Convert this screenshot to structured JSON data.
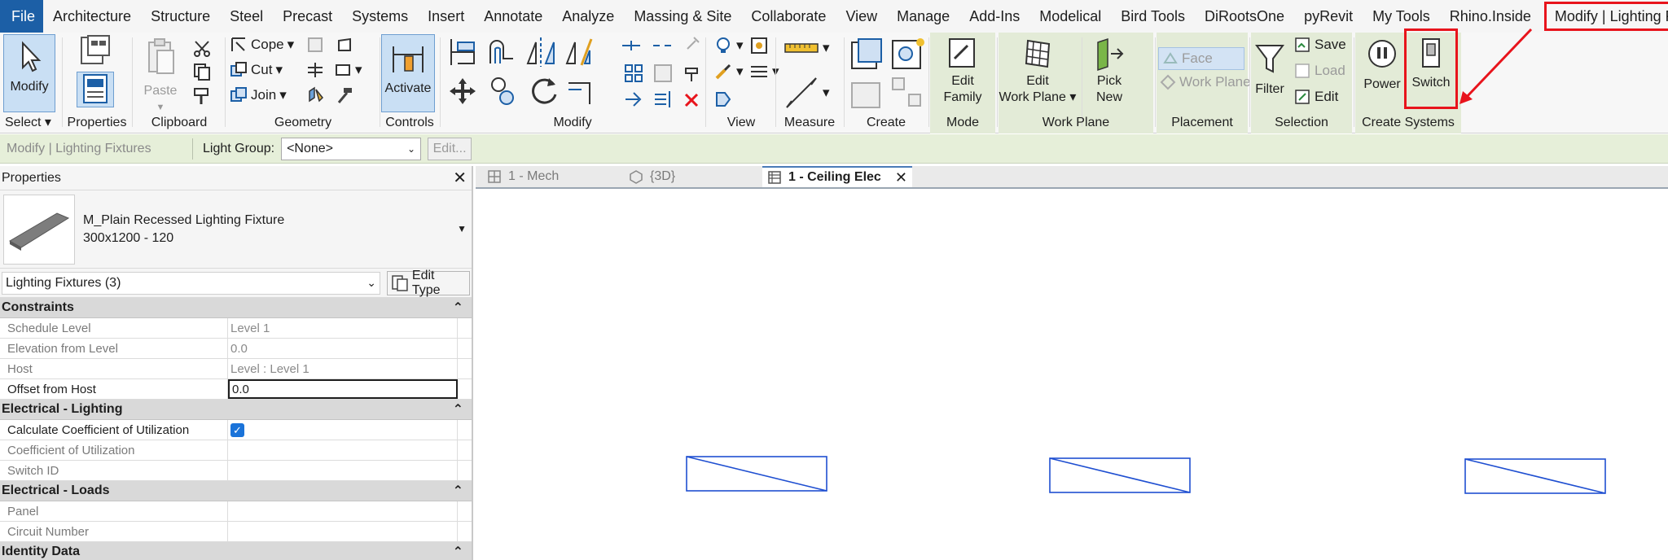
{
  "menu": {
    "file": "File",
    "tabs": [
      "Architecture",
      "Structure",
      "Steel",
      "Precast",
      "Systems",
      "Insert",
      "Annotate",
      "Analyze",
      "Massing & Site",
      "Collaborate",
      "View",
      "Manage",
      "Add-Ins",
      "Modelical",
      "Bird Tools",
      "DiRootsOne",
      "pyRevit",
      "My Tools",
      "Rhino.Inside"
    ],
    "context_tab": "Modify | Lighting Fixtures"
  },
  "ribbon": {
    "select": {
      "modify": "Modify",
      "label": "Select"
    },
    "properties": {
      "label": "Properties"
    },
    "clipboard": {
      "paste": "Paste",
      "label": "Clipboard"
    },
    "geometry": {
      "cope": "Cope",
      "cut": "Cut",
      "join": "Join",
      "label": "Geometry"
    },
    "controls": {
      "activate": "Activate",
      "label": "Controls"
    },
    "modify": {
      "label": "Modify"
    },
    "view": {
      "label": "View"
    },
    "measure": {
      "label": "Measure"
    },
    "create": {
      "label": "Create"
    },
    "mode": {
      "edit_family_1": "Edit",
      "edit_family_2": "Family",
      "label": "Mode"
    },
    "work_plane": {
      "edit_1": "Edit",
      "edit_2": "Work Plane",
      "pick_1": "Pick",
      "pick_2": "New",
      "label": "Work Plane"
    },
    "placement": {
      "face": "Face",
      "work_plane": "Work Plane",
      "label": "Placement"
    },
    "selection": {
      "filter": "Filter",
      "save": "Save",
      "load": "Load",
      "edit": "Edit",
      "label": "Selection"
    },
    "create_systems": {
      "power": "Power",
      "switch": "Switch",
      "label": "Create Systems"
    }
  },
  "options_bar": {
    "context": "Modify | Lighting Fixtures",
    "light_group_label": "Light Group:",
    "light_group_value": "<None>",
    "edit_button": "Edit..."
  },
  "properties": {
    "title": "Properties",
    "type_name_1": "M_Plain Recessed Lighting Fixture",
    "type_name_2": "300x1200 - 120",
    "instance_filter": "Lighting Fixtures (3)",
    "edit_type": "Edit Type",
    "groups": [
      {
        "name": "Constraints",
        "rows": [
          {
            "name": "Schedule Level",
            "value": "Level 1"
          },
          {
            "name": "Elevation from Level",
            "value": "0.0"
          },
          {
            "name": "Host",
            "value": "Level : Level 1"
          },
          {
            "name": "Offset from Host",
            "value": "0.0"
          }
        ]
      },
      {
        "name": "Electrical - Lighting",
        "rows": [
          {
            "name": "Calculate Coefficient of Utilization",
            "value": ""
          },
          {
            "name": "Coefficient of Utilization",
            "value": ""
          },
          {
            "name": "Switch ID",
            "value": ""
          }
        ]
      },
      {
        "name": "Electrical - Loads",
        "rows": [
          {
            "name": "Panel",
            "value": ""
          },
          {
            "name": "Circuit Number",
            "value": ""
          }
        ]
      },
      {
        "name": "Identity Data",
        "rows": []
      }
    ]
  },
  "view_tabs": [
    {
      "label": "1 - Mech"
    },
    {
      "label": "{3D}"
    },
    {
      "label": "1 - Ceiling Elec"
    }
  ],
  "colors": {
    "accent": "#1c5fa6",
    "highlight": "#e8141c",
    "fixture": "#1f4fd1"
  }
}
